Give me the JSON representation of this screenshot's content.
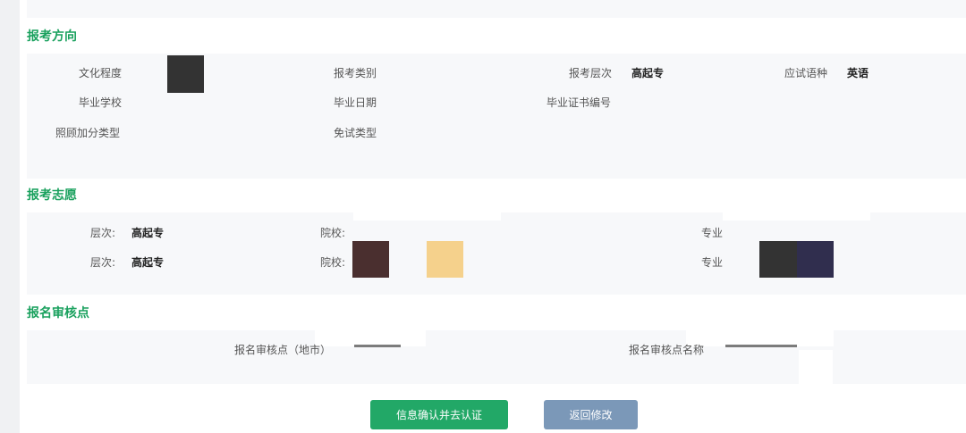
{
  "sections": {
    "direction": {
      "title": "报考方向",
      "fields": {
        "education_label": "文化程度",
        "exam_category_label": "报考类别",
        "exam_level_label": "报考层次",
        "exam_level_value": "高起专",
        "language_label": "应试语种",
        "language_value": "英语",
        "grad_school_label": "毕业学校",
        "grad_date_label": "毕业日期",
        "certificate_no_label": "毕业证书编号",
        "bonus_type_label": "照顾加分类型",
        "exemption_type_label": "免试类型"
      }
    },
    "wishes": {
      "title": "报考志愿",
      "rows": [
        {
          "level_label": "层次:",
          "level_value": "高起专",
          "school_label": "院校:",
          "major_label": "专业"
        },
        {
          "level_label": "层次:",
          "level_value": "高起专",
          "school_label": "院校:",
          "major_label": "专业"
        }
      ]
    },
    "review": {
      "title": "报名审核点",
      "city_label": "报名审核点（地市）",
      "name_label": "报名审核点名称"
    }
  },
  "buttons": {
    "confirm": "信息确认并去认证",
    "back": "返回修改"
  },
  "colors": {
    "accent_green": "#1aa15e",
    "confirm_button": "#22a867",
    "back_button": "#7b98b8",
    "panel_bg": "#f7f8fa",
    "redact_dark": "#333333",
    "redact_brown": "#4a2f2f",
    "redact_peach": "#f5d18c",
    "redact_navy": "#302e4e"
  }
}
